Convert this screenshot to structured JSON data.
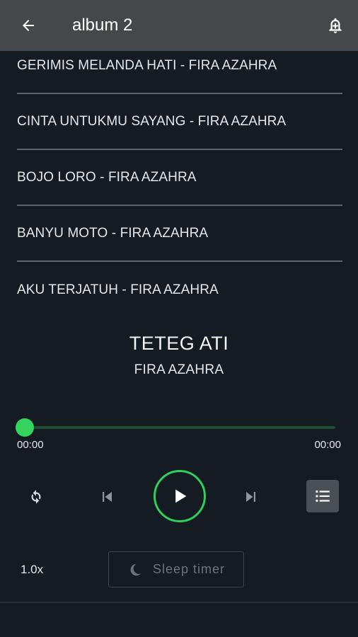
{
  "appbar": {
    "title": "album 2",
    "back_icon": "arrow-left-icon",
    "bell_icon": "notification-add-icon"
  },
  "tracks": [
    {
      "label": "GERIMIS MELANDA HATI - FIRA AZAHRA"
    },
    {
      "label": "CINTA UNTUKMU SAYANG - FIRA AZAHRA"
    },
    {
      "label": "BOJO LORO - FIRA AZAHRA"
    },
    {
      "label": "BANYU MOTO - FIRA AZAHRA"
    },
    {
      "label": "AKU TERJATUH - FIRA AZAHRA"
    }
  ],
  "now_playing": {
    "title": "TETEG ATI",
    "artist": "FIRA AZAHRA",
    "progress": 0,
    "current_time": "00:00",
    "duration": "00:00"
  },
  "controls": {
    "repeat_icon": "repeat-icon",
    "prev_icon": "skip-previous-icon",
    "play_icon": "play-icon",
    "next_icon": "skip-next-icon",
    "queue_icon": "queue-list-icon"
  },
  "footer": {
    "speed": "1.0x",
    "sleep_label": "Sleep timer",
    "sleep_icon": "moon-icon"
  },
  "colors": {
    "accent": "#2fcf5c",
    "appbar": "#45474b",
    "background": "#141b22"
  }
}
